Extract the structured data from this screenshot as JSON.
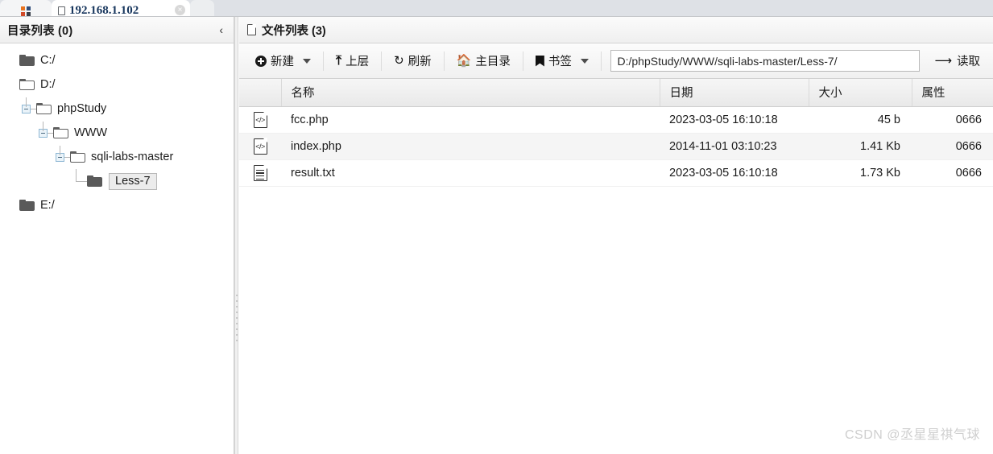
{
  "browser": {
    "apps_tab": {
      "icon": "apps-grid-icon",
      "colors": [
        "#e8731f",
        "#2f4d7a",
        "#d14b2a",
        "#3a3f4a"
      ]
    },
    "active_tab": {
      "title": "192.168.1.102",
      "icon": "page-icon",
      "close_label": "×"
    }
  },
  "sidebar": {
    "header": {
      "title": "目录列表 (0)",
      "collapse_icon": "‹"
    },
    "tree": [
      {
        "label": "C:/",
        "depth": 0,
        "folder": "filled",
        "expander": "none",
        "selected": false
      },
      {
        "label": "D:/",
        "depth": 0,
        "folder": "open",
        "expander": "none",
        "selected": false
      },
      {
        "label": "phpStudy",
        "depth": 1,
        "folder": "open",
        "expander": "minus",
        "selected": false
      },
      {
        "label": "WWW",
        "depth": 2,
        "folder": "open",
        "expander": "minus",
        "selected": false
      },
      {
        "label": "sqli-labs-master",
        "depth": 3,
        "folder": "open",
        "expander": "minus",
        "selected": false
      },
      {
        "label": "Less-7",
        "depth": 4,
        "folder": "filled",
        "expander": "elbow",
        "selected": true
      },
      {
        "label": "E:/",
        "depth": 0,
        "folder": "filled",
        "expander": "none",
        "selected": false
      }
    ]
  },
  "main": {
    "header": {
      "title": "文件列表 (3)",
      "icon": "page-icon"
    },
    "toolbar": {
      "new_label": "新建",
      "new_icon": "plus-circle-icon",
      "up_label": "上层",
      "up_icon": "arrow-up-icon",
      "refresh_label": "刷新",
      "refresh_icon": "refresh-icon",
      "home_label": "主目录",
      "home_icon": "home-icon",
      "bookmark_label": "书签",
      "bookmark_icon": "bookmark-icon",
      "read_label": "读取",
      "read_icon": "arrow-right-icon",
      "path_value": "D:/phpStudy/WWW/sqli-labs-master/Less-7/",
      "path_placeholder": "D:/phpStudy/WWW/sqli-labs-master/Less-7/"
    },
    "table": {
      "columns": [
        "名称",
        "日期",
        "大小",
        "属性"
      ],
      "rows": [
        {
          "icon": "code-file-icon",
          "name": "fcc.php",
          "date": "2023-03-05 16:10:18",
          "size": "45 b",
          "attr": "0666"
        },
        {
          "icon": "code-file-icon",
          "name": "index.php",
          "date": "2014-11-01 03:10:23",
          "size": "1.41 Kb",
          "attr": "0666"
        },
        {
          "icon": "text-file-icon",
          "name": "result.txt",
          "date": "2023-03-05 16:10:18",
          "size": "1.73 Kb",
          "attr": "0666"
        }
      ]
    }
  },
  "watermark": {
    "text": "CSDN @丞星星祺气球"
  }
}
